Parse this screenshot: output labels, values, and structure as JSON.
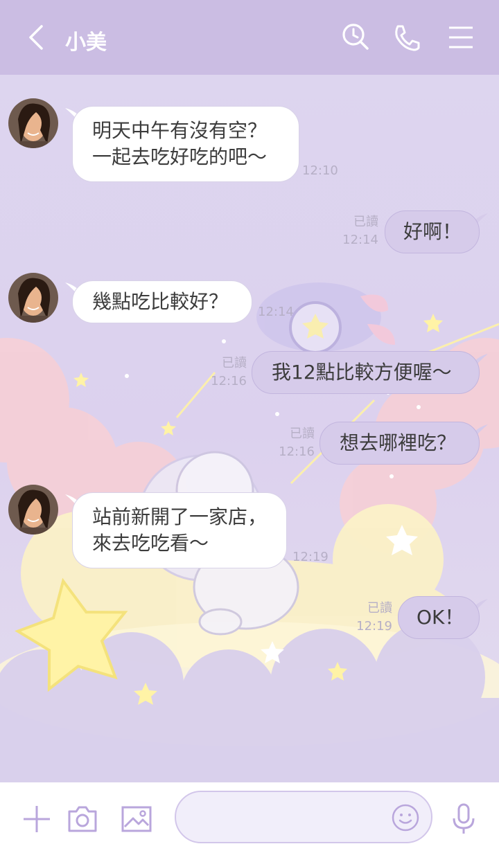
{
  "header": {
    "contact_name": "小美",
    "back_icon": "chevron-left-icon",
    "search_icon": "search-icon",
    "call_icon": "phone-icon",
    "menu_icon": "menu-icon"
  },
  "messages": [
    {
      "side": "in",
      "lines": [
        "明天中午有沒有空？",
        "一起去吃好吃的吧～"
      ],
      "time": "12:10"
    },
    {
      "side": "out",
      "lines": [
        "好啊！"
      ],
      "read": "已讀",
      "time": "12:14"
    },
    {
      "side": "in",
      "lines": [
        "幾點吃比較好？"
      ],
      "time": "12:14"
    },
    {
      "side": "out",
      "lines": [
        "我12點比較方便喔～"
      ],
      "read": "已讀",
      "time": "12:16"
    },
    {
      "side": "out",
      "lines": [
        "想去哪裡吃？"
      ],
      "read": "已讀",
      "time": "12:16"
    },
    {
      "side": "in",
      "lines": [
        "站前新開了一家店，",
        "來去吃吃看～"
      ],
      "time": "12:19"
    },
    {
      "side": "out",
      "lines": [
        "OK！"
      ],
      "read": "已讀",
      "time": "12:19"
    }
  ],
  "input": {
    "value": "",
    "placeholder": "",
    "add_icon": "plus-icon",
    "camera_icon": "camera-icon",
    "image_icon": "image-icon",
    "emoji_icon": "smiley-icon",
    "mic_icon": "microphone-icon"
  },
  "colors": {
    "header_bg": "#cbbde3",
    "chat_bg": "#ddd5ef",
    "incoming_bubble": "#ffffff",
    "outgoing_bubble": "#d6cbea",
    "accent": "#b9a6dc"
  }
}
